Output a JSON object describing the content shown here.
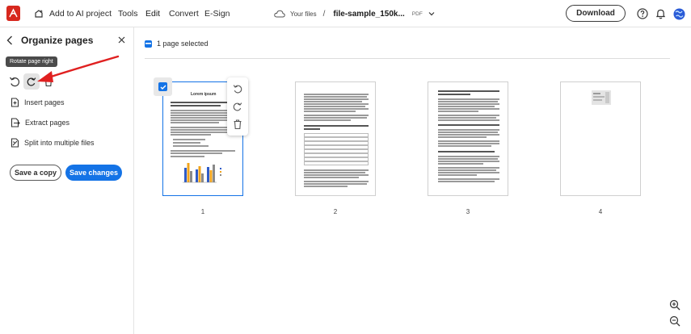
{
  "topbar": {
    "ai_project_label": "Add to AI project",
    "tabs": [
      {
        "label": "Tools"
      },
      {
        "label": "Edit"
      },
      {
        "label": "Convert"
      },
      {
        "label": "E-Sign"
      }
    ],
    "your_files": "Your files",
    "file_name": "file-sample_150k...",
    "file_type": "PDF",
    "download_label": "Download"
  },
  "panel": {
    "title": "Organize pages",
    "tooltip": "Rotate page right",
    "actions": [
      {
        "label": "Insert pages",
        "icon": "insert-pages-icon"
      },
      {
        "label": "Extract pages",
        "icon": "extract-pages-icon"
      },
      {
        "label": "Split into multiple files",
        "icon": "split-icon"
      }
    ],
    "save_copy_label": "Save a copy",
    "save_changes_label": "Save changes"
  },
  "main": {
    "selection_text": "1 page selected",
    "pages": [
      {
        "number": "1",
        "selected": true,
        "title": "Lorem ipsum"
      },
      {
        "number": "2",
        "selected": false
      },
      {
        "number": "3",
        "selected": false
      },
      {
        "number": "4",
        "selected": false
      }
    ]
  },
  "colors": {
    "accent": "#1473e6",
    "brand_red": "#d7281e",
    "annotation_arrow": "#e02020"
  }
}
